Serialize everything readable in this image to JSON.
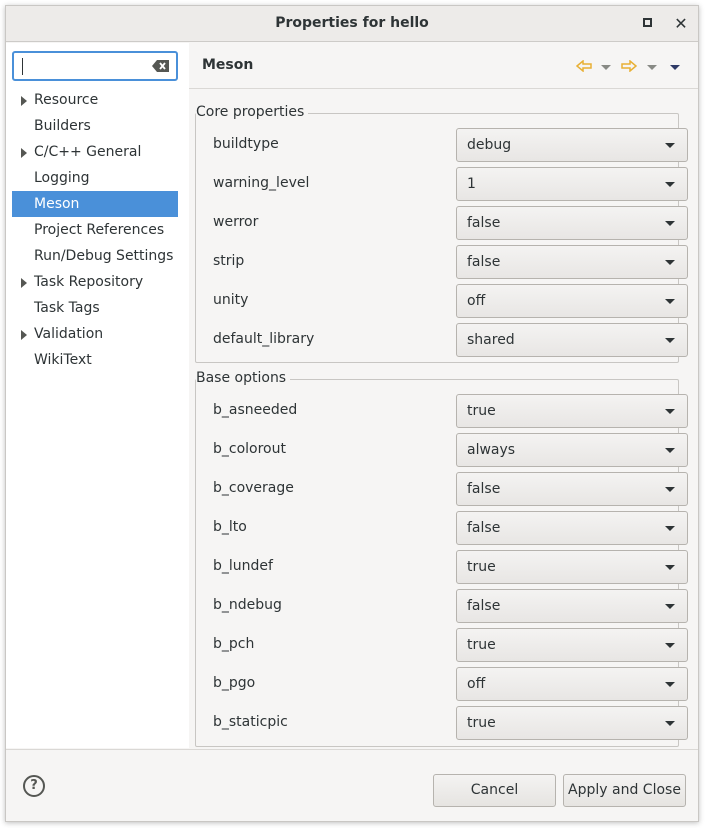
{
  "window": {
    "title": "Properties for hello"
  },
  "filter": {
    "value": ""
  },
  "tree": {
    "items": [
      {
        "label": "Resource",
        "expandable": true,
        "selected": false
      },
      {
        "label": "Builders",
        "expandable": false,
        "selected": false
      },
      {
        "label": "C/C++ General",
        "expandable": true,
        "selected": false
      },
      {
        "label": "Logging",
        "expandable": false,
        "selected": false
      },
      {
        "label": "Meson",
        "expandable": false,
        "selected": true
      },
      {
        "label": "Project References",
        "expandable": false,
        "selected": false
      },
      {
        "label": "Run/Debug Settings",
        "expandable": false,
        "selected": false
      },
      {
        "label": "Task Repository",
        "expandable": true,
        "selected": false
      },
      {
        "label": "Task Tags",
        "expandable": false,
        "selected": false
      },
      {
        "label": "Validation",
        "expandable": true,
        "selected": false
      },
      {
        "label": "WikiText",
        "expandable": false,
        "selected": false
      }
    ]
  },
  "page": {
    "title": "Meson",
    "core": {
      "legend": "Core properties",
      "rows": [
        {
          "label": "buildtype",
          "value": "debug"
        },
        {
          "label": "warning_level",
          "value": "1"
        },
        {
          "label": "werror",
          "value": "false"
        },
        {
          "label": "strip",
          "value": "false"
        },
        {
          "label": "unity",
          "value": "off"
        },
        {
          "label": "default_library",
          "value": "shared"
        }
      ]
    },
    "base": {
      "legend": "Base options",
      "rows": [
        {
          "label": "b_asneeded",
          "value": "true"
        },
        {
          "label": "b_colorout",
          "value": "always"
        },
        {
          "label": "b_coverage",
          "value": "false"
        },
        {
          "label": "b_lto",
          "value": "false"
        },
        {
          "label": "b_lundef",
          "value": "true"
        },
        {
          "label": "b_ndebug",
          "value": "false"
        },
        {
          "label": "b_pch",
          "value": "true"
        },
        {
          "label": "b_pgo",
          "value": "off"
        },
        {
          "label": "b_staticpic",
          "value": "true"
        }
      ]
    }
  },
  "footer": {
    "help": "?",
    "cancel_label": "Cancel",
    "apply_label": "Apply and Close"
  },
  "colors": {
    "selection": "#4a90d9",
    "nav_arrow": "#e8b035",
    "background": "#f6f5f4"
  },
  "icons": {
    "clear": "clear-text-icon",
    "back": "back-arrow-icon",
    "forward": "forward-arrow-icon",
    "help": "help-icon"
  }
}
